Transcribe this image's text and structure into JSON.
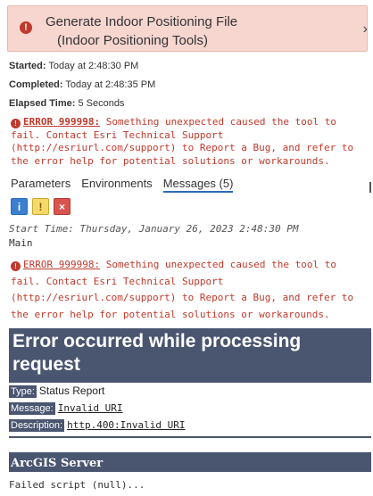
{
  "banner": {
    "title_line1": "Generate Indoor Positioning File",
    "title_line2": "(Indoor Positioning Tools)",
    "close": "›"
  },
  "meta": {
    "started_label": "Started:",
    "started_value": "Today at 2:48:30 PM",
    "completed_label": "Completed:",
    "completed_value": "Today at 2:48:35 PM",
    "elapsed_label": "Elapsed Time:",
    "elapsed_value": "5 Seconds"
  },
  "summary_error": {
    "code": "ERROR 999998:",
    "message": " Something unexpected caused the tool to fail. Contact Esri Technical Support (http://esriurl.com/support) to Report a Bug, and refer to the error help for potential solutions or workarounds."
  },
  "tabs": [
    "Parameters",
    "Environments",
    "Messages (5)"
  ],
  "filters": {
    "info": "i",
    "warning": "!",
    "error": "×"
  },
  "messages": {
    "start_time": "Start Time: Thursday, January 26, 2023 2:48:30 PM",
    "main": "Main",
    "error_code": "ERROR 999998:",
    "error_text": " Something unexpected caused the tool to fail. Contact Esri Technical Support (http://esriurl.com/support) to Report a Bug, and refer to the error help for potential solutions or workarounds."
  },
  "response": {
    "heading": "Error occurred while processing request",
    "type_label": "Type:",
    "type_value": "Status Report",
    "message_label": "Message:",
    "message_value": "Invalid URI",
    "description_label": "Description:",
    "description_value": "http.400:Invalid URI",
    "server": "ArcGIS Server",
    "failed": "Failed script (null)..."
  },
  "colors": {
    "error": "#c0392b",
    "banner_bg": "#f7d6d0",
    "header_bg": "#4a5570",
    "tab_accent": "#2a6db5"
  }
}
